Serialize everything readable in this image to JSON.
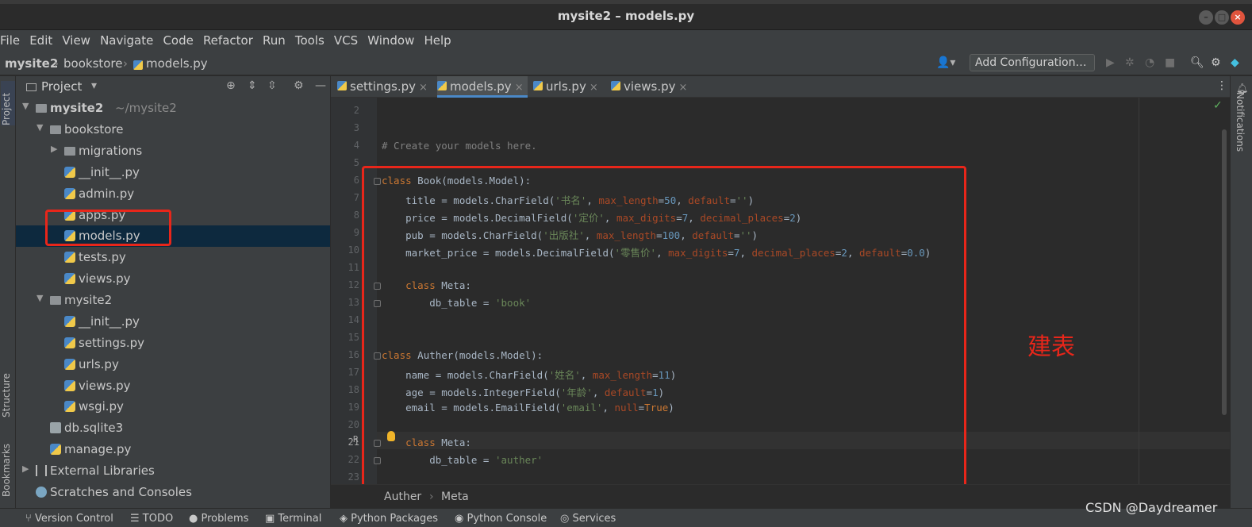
{
  "window": {
    "title": "mysite2 – models.py"
  },
  "menu": [
    "File",
    "Edit",
    "View",
    "Navigate",
    "Code",
    "Refactor",
    "Run",
    "Tools",
    "VCS",
    "Window",
    "Help"
  ],
  "breadcrumb": [
    "mysite2",
    "bookstore",
    "models.py"
  ],
  "toolbar": {
    "add_configuration": "Add Configuration…"
  },
  "side_tabs": {
    "project": "Project",
    "structure": "Structure",
    "bookmarks": "Bookmarks",
    "notifications": "Notifications"
  },
  "project_panel": {
    "title": "Project",
    "root": {
      "name": "mysite2",
      "path": "~/mysite2"
    },
    "items": [
      "bookstore",
      "migrations",
      "__init__.py",
      "admin.py",
      "apps.py",
      "models.py",
      "tests.py",
      "views.py",
      "mysite2",
      "__init__.py",
      "settings.py",
      "urls.py",
      "views.py",
      "wsgi.py",
      "db.sqlite3",
      "manage.py",
      "External Libraries",
      "Scratches and Consoles"
    ]
  },
  "tabs": [
    "settings.py",
    "models.py",
    "urls.py",
    "views.py"
  ],
  "editor": {
    "line_numbers": [
      "2",
      "3",
      "4",
      "5",
      "6",
      "7",
      "8",
      "9",
      "10",
      "11",
      "12",
      "13",
      "14",
      "15",
      "16",
      "17",
      "18",
      "19",
      "20",
      "21",
      "22",
      "23"
    ],
    "lines": {
      "l4": "# Create your models here.",
      "l6_kw": "class",
      "l6_rest": " Book(models.Model):",
      "l7_a": "    title = models.CharField(",
      "l7_s": "'书名'",
      "l7_b": ", ",
      "l7_p1": "max_length",
      "l7_c": "=",
      "l7_n1": "50",
      "l7_d": ", ",
      "l7_p2": "default",
      "l7_e": "=",
      "l7_s2": "''",
      "l7_f": ")",
      "l8_a": "    price = models.DecimalField(",
      "l8_s": "'定价'",
      "l8_b": ", ",
      "l8_p1": "max_digits",
      "l8_c": "=",
      "l8_n1": "7",
      "l8_d": ", ",
      "l8_p2": "decimal_places",
      "l8_e": "=",
      "l8_n2": "2",
      "l8_f": ")",
      "l9_a": "    pub = models.CharField(",
      "l9_s": "'出版社'",
      "l9_b": ", ",
      "l9_p1": "max_length",
      "l9_c": "=",
      "l9_n1": "100",
      "l9_d": ", ",
      "l9_p2": "default",
      "l9_e": "=",
      "l9_s2": "''",
      "l9_f": ")",
      "l10_a": "    market_price = models.DecimalField(",
      "l10_s": "'零售价'",
      "l10_b": ", ",
      "l10_p1": "max_digits",
      "l10_c": "=",
      "l10_n1": "7",
      "l10_d": ", ",
      "l10_p2": "decimal_places",
      "l10_e": "=",
      "l10_n2": "2",
      "l10_g": ", ",
      "l10_p3": "default",
      "l10_h": "=",
      "l10_n3": "0.0",
      "l10_f": ")",
      "l12_kw": "    class",
      "l12_rest": " Meta:",
      "l13_a": "        db_table = ",
      "l13_s": "'book'",
      "l16_kw": "class",
      "l16_rest": " Auther(models.Model):",
      "l17_a": "    name = models.CharField(",
      "l17_s": "'姓名'",
      "l17_b": ", ",
      "l17_p1": "max_length",
      "l17_c": "=",
      "l17_n1": "11",
      "l17_f": ")",
      "l18_a": "    age = models.IntegerField(",
      "l18_s": "'年龄'",
      "l18_b": ", ",
      "l18_p1": "default",
      "l18_c": "=",
      "l18_n1": "1",
      "l18_f": ")",
      "l19_a": "    email = models.EmailField(",
      "l19_s": "'email'",
      "l19_b": ", ",
      "l19_p1": "null",
      "l19_c": "=",
      "l19_k": "True",
      "l19_f": ")",
      "l21_kw": "    class",
      "l21_rest": " Meta:",
      "l22_a": "        db_table = ",
      "l22_s": "'auther'"
    },
    "gutter_marker": "R"
  },
  "annotation": "建表",
  "code_breadcrumb": [
    "Auther",
    "Meta"
  ],
  "statusbar": [
    "Version Control",
    "TODO",
    "Problems",
    "Terminal",
    "Python Packages",
    "Python Console",
    "Services"
  ],
  "watermark": "CSDN @Daydreamer",
  "colors": {
    "annotation_red": "#e8261a",
    "keyword": "#cc7832",
    "string": "#6a8759",
    "number": "#6897bb",
    "param": "#aa4926"
  }
}
